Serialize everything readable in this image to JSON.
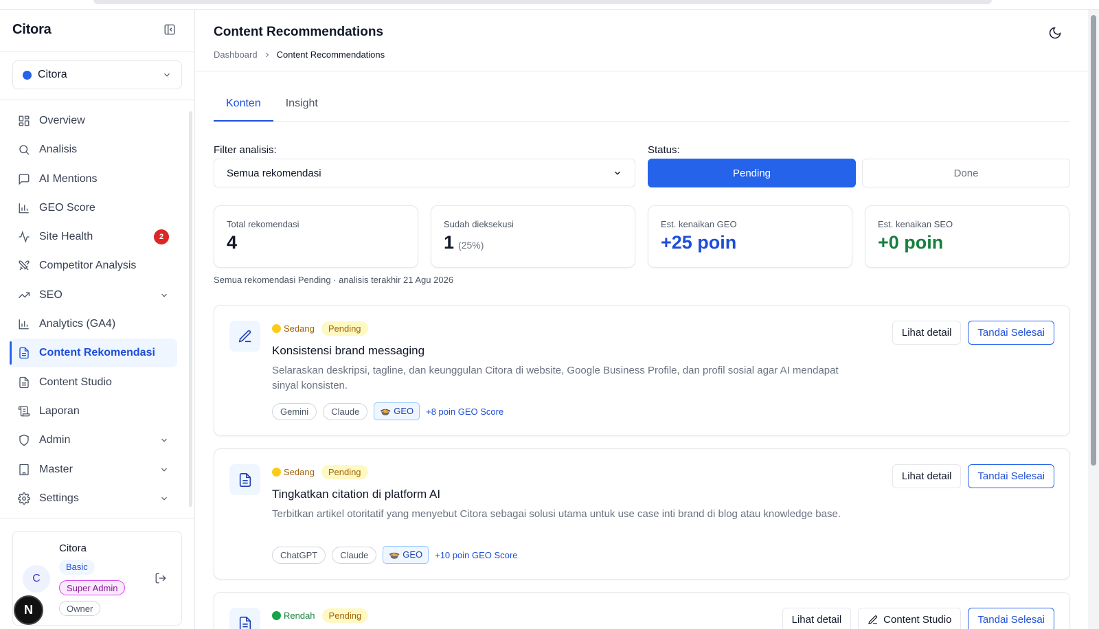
{
  "app": {
    "brand": "Citora"
  },
  "project": {
    "name": "Citora"
  },
  "nav": [
    {
      "label": "Overview",
      "icon": "grid-icon"
    },
    {
      "label": "Analisis",
      "icon": "search-icon"
    },
    {
      "label": "AI Mentions",
      "icon": "message-icon"
    },
    {
      "label": "GEO Score",
      "icon": "bar-chart-icon"
    },
    {
      "label": "Site Health",
      "icon": "activity-icon",
      "badge": "2"
    },
    {
      "label": "Competitor Analysis",
      "icon": "swords-icon"
    },
    {
      "label": "SEO",
      "icon": "trend-up-icon",
      "expandable": true
    },
    {
      "label": "Analytics (GA4)",
      "icon": "bar-chart-icon"
    },
    {
      "label": "Content Rekomendasi",
      "icon": "file-text-icon",
      "active": true
    },
    {
      "label": "Content Studio",
      "icon": "file-text-icon"
    },
    {
      "label": "Laporan",
      "icon": "scroll-icon"
    },
    {
      "label": "Admin",
      "icon": "shield-icon",
      "expandable": true
    },
    {
      "label": "Master",
      "icon": "building-icon",
      "expandable": true
    },
    {
      "label": "Settings",
      "icon": "gear-icon",
      "expandable": true
    }
  ],
  "user": {
    "name": "Citora",
    "initial": "C",
    "plan": "Basic",
    "role": "Super Admin",
    "membership": "Owner"
  },
  "floating_badge": "N",
  "header": {
    "title": "Content Recommendations",
    "breadcrumb": [
      "Dashboard",
      "Content Recommendations"
    ]
  },
  "tabs": [
    {
      "label": "Konten",
      "active": true
    },
    {
      "label": "Insight",
      "active": false
    }
  ],
  "filter": {
    "label": "Filter analisis:",
    "value": "Semua rekomendasi"
  },
  "status": {
    "label": "Status:",
    "options": [
      "Pending",
      "Done"
    ],
    "selected": "Pending"
  },
  "stats": [
    {
      "label": "Total rekomendasi",
      "value": "4",
      "extra": ""
    },
    {
      "label": "Sudah dieksekusi",
      "value": "1",
      "extra": "(25%)"
    },
    {
      "label": "Est. kenaikan GEO",
      "value": "+25 poin",
      "extra": ""
    },
    {
      "label": "Est. kenaikan SEO",
      "value": "+0 poin",
      "extra": ""
    }
  ],
  "summary_note": "Semua rekomendasi Pending · analisis terakhir 21 Agu 2026",
  "cards": [
    {
      "priority": "Sedang",
      "status": "Pending",
      "title": "Konsistensi brand messaging",
      "description": "Selaraskan deskripsi, tagline, dan keunggulan Citora di website, Google Business Profile, dan profil sosial agar AI mendapat sinyal konsisten.",
      "tags": [
        "Gemini",
        "Claude"
      ],
      "category": "GEO",
      "gain": "+8 poin GEO Score",
      "actions": [
        "Lihat detail",
        "Tandai Selesai"
      ]
    },
    {
      "priority": "Sedang",
      "status": "Pending",
      "title": "Tingkatkan citation di platform AI",
      "description": "Terbitkan artikel otoritatif yang menyebut Citora sebagai solusi utama untuk use case inti brand di blog atau knowledge base.",
      "tags": [
        "ChatGPT",
        "Claude"
      ],
      "category": "GEO",
      "gain": "+10 poin GEO Score",
      "actions": [
        "Lihat detail",
        "Tandai Selesai"
      ]
    },
    {
      "priority": "Rendah",
      "status": "Pending",
      "actions": [
        "Lihat detail",
        "Content Studio",
        "Tandai Selesai"
      ]
    }
  ],
  "colors": {
    "accent": "#2563eb",
    "priority_medium": "#facc15",
    "priority_low": "#16a34a",
    "badge_red": "#dc2626"
  }
}
